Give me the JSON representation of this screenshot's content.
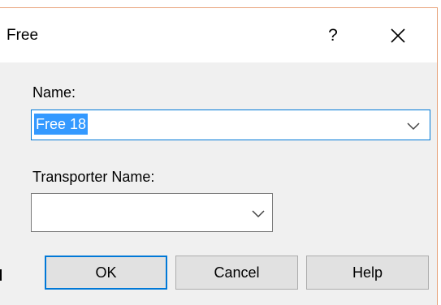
{
  "dialog": {
    "title": "Free",
    "help_glyph": "?",
    "close_icon": "close-x-icon"
  },
  "name_field": {
    "label": "Name:",
    "value": "Free 18",
    "dropdown_icon": "chevron-down-icon"
  },
  "transporter_field": {
    "label": "Transporter Name:",
    "value": "",
    "dropdown_icon": "chevron-down-icon"
  },
  "buttons": {
    "ok": "OK",
    "cancel": "Cancel",
    "help": "Help"
  },
  "colors": {
    "accent": "#0078d7",
    "selection": "#3399ff",
    "window_border": "#e8a27a"
  }
}
